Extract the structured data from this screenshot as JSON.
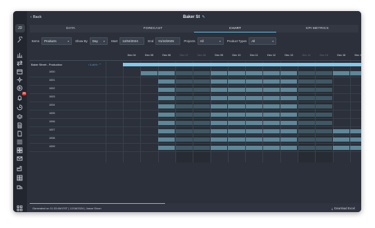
{
  "window": {
    "title": "Baker St",
    "back_label": "Back"
  },
  "sidebar": {
    "avatar_initials": "JD",
    "notification_count": "99",
    "icons": [
      "wrench-icon",
      "chart-icon",
      "arrows-icon",
      "calendar-icon",
      "gear-icon",
      "circle-play-icon",
      "bell-icon",
      "history-icon",
      "layers-icon",
      "document-icon",
      "file-icon",
      "list-icon",
      "grid-icon",
      "mail-icon",
      "factory-icon",
      "table-icon",
      "truck-icon",
      "apps-icon"
    ]
  },
  "tabs": [
    {
      "label": "DATA",
      "active": false
    },
    {
      "label": "FORECAST",
      "active": false
    },
    {
      "label": "CHART",
      "active": true
    },
    {
      "label": "KPI METRICS",
      "active": false
    }
  ],
  "filters": {
    "items_label": "Items",
    "items_value": "Products",
    "show_by_label": "Show By",
    "show_by_value": "Day",
    "start_label": "Start",
    "start_value": "12/04/2024",
    "end_label": "End",
    "end_value": "01/10/2025",
    "projects_label": "Projects",
    "projects_value": "All",
    "product_types_label": "Product Types",
    "product_types_value": "All"
  },
  "gantt": {
    "dates": [
      {
        "label": "Dec 04",
        "muted": false
      },
      {
        "label": "Dec 05",
        "muted": false
      },
      {
        "label": "Dec 06",
        "muted": false
      },
      {
        "label": "Dec 07",
        "muted": true
      },
      {
        "label": "Dec 08",
        "muted": true
      },
      {
        "label": "Dec 09",
        "muted": false
      },
      {
        "label": "Dec 10",
        "muted": false
      },
      {
        "label": "Dec 11",
        "muted": false
      },
      {
        "label": "Dec 12",
        "muted": false
      },
      {
        "label": "Dec 13",
        "muted": false
      },
      {
        "label": "Dec 14",
        "muted": true
      },
      {
        "label": "Dec 15",
        "muted": true
      },
      {
        "label": "Dec 16",
        "muted": false
      },
      {
        "label": "Dec 17",
        "muted": false
      },
      {
        "label": "Dec 18",
        "muted": false
      }
    ],
    "product_row": {
      "label": "Baker Street - Production",
      "pager": "1 of 4"
    },
    "tasks": [
      {
        "label": "1000",
        "start": 1,
        "end": 15
      },
      {
        "label": "1001",
        "start": 2,
        "end": 12
      },
      {
        "label": "1002",
        "start": 2,
        "end": 12
      },
      {
        "label": "1003",
        "start": 2,
        "end": 12
      },
      {
        "label": "1004",
        "start": 2,
        "end": 12
      },
      {
        "label": "1005",
        "start": 2,
        "end": 12
      },
      {
        "label": "1006",
        "start": 2,
        "end": 12
      },
      {
        "label": "1007",
        "start": 2,
        "end": 14
      },
      {
        "label": "1008",
        "start": 2,
        "end": 14
      },
      {
        "label": "1009",
        "start": 2,
        "end": 14
      }
    ]
  },
  "footer": {
    "generated": "Generated on 11:33 AM EST | 12/18/2024 | Jason Dixon",
    "download": "Download Excel"
  },
  "colors": {
    "bar_light": "#7ecbee",
    "bar_dark": "#5d8899",
    "bar_dim": "#3f5865",
    "weekend": "#272b33"
  }
}
